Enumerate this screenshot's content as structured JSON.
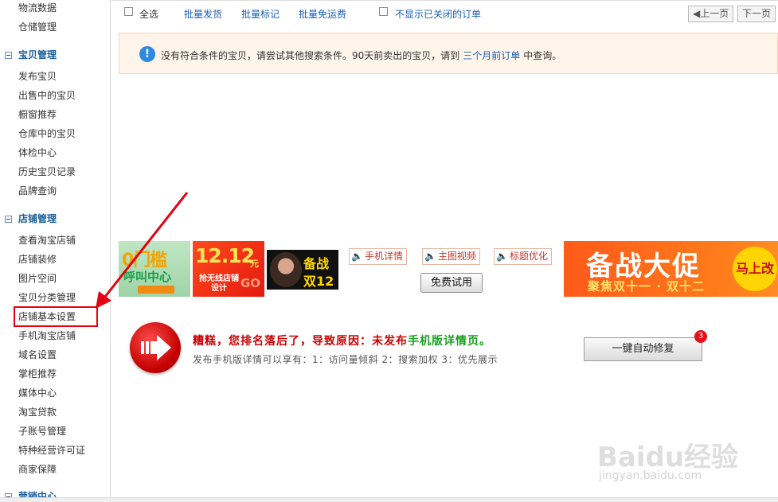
{
  "sidebar": {
    "top_items": [
      "物流数据",
      "仓储管理"
    ],
    "section_goods": {
      "title": "宝贝管理",
      "items": [
        "发布宝贝",
        "出售中的宝贝",
        "橱窗推荐",
        "仓库中的宝贝",
        "体检中心",
        "历史宝贝记录",
        "品牌查询"
      ]
    },
    "section_store": {
      "title": "店铺管理",
      "items": [
        "查看淘宝店铺",
        "店铺装修",
        "图片空间",
        "宝贝分类管理",
        "店铺基本设置",
        "手机淘宝店铺",
        "域名设置",
        "掌柜推荐",
        "媒体中心",
        "淘宝贷款",
        "子账号管理",
        "特种经营许可证",
        "商家保障"
      ]
    },
    "section_marketing": {
      "title": "营销中心"
    }
  },
  "toolbar": {
    "select_all": "全选",
    "batch_ship": "批量发货",
    "batch_mark": "批量标记",
    "batch_free_ship": "批量免运费",
    "hide_closed": "不显示已关闭的订单",
    "prev_page": "上一页",
    "next_page": "下一页"
  },
  "notice": {
    "text_before": "没有符合条件的宝贝，请尝试其他搜索条件。90天前卖出的宝贝，请到",
    "link": "三个月前订单",
    "text_after": "中查询。"
  },
  "banners": {
    "b1_big": "0门槛",
    "b1_sub": "呼叫中心",
    "b2_big": "12.12",
    "b2_unit": "元",
    "b2_sub": "抢无线店铺设计",
    "b2_go": "GO",
    "b3_line1": "备战",
    "b3_line2": "双12",
    "b4_big": "备战大促",
    "b4_sub": "聚焦双十一 · 双十二",
    "b4_badge": "马上改变"
  },
  "tags": {
    "mobile_detail": "手机详情",
    "main_video": "主图视频",
    "title_opt": "标题优化",
    "free_trial": "免费试用"
  },
  "warning": {
    "title_prefix": "糟糕，您排名落后了，导致原因：未发布",
    "title_highlight": "手机版详情页",
    "title_suffix": "。",
    "subtitle": "发布手机版详情可以享有：1：访问量倾斜 2：搜索加权 3：优先展示",
    "fix_button": "一键自动修复",
    "fix_badge": "3"
  },
  "watermark": {
    "main": "Baidu经验",
    "url": "jingyan.baidu.com"
  },
  "colors": {
    "accent_blue": "#1a5fb4",
    "alert_red": "#e60012",
    "highlight_green": "#19a020"
  }
}
